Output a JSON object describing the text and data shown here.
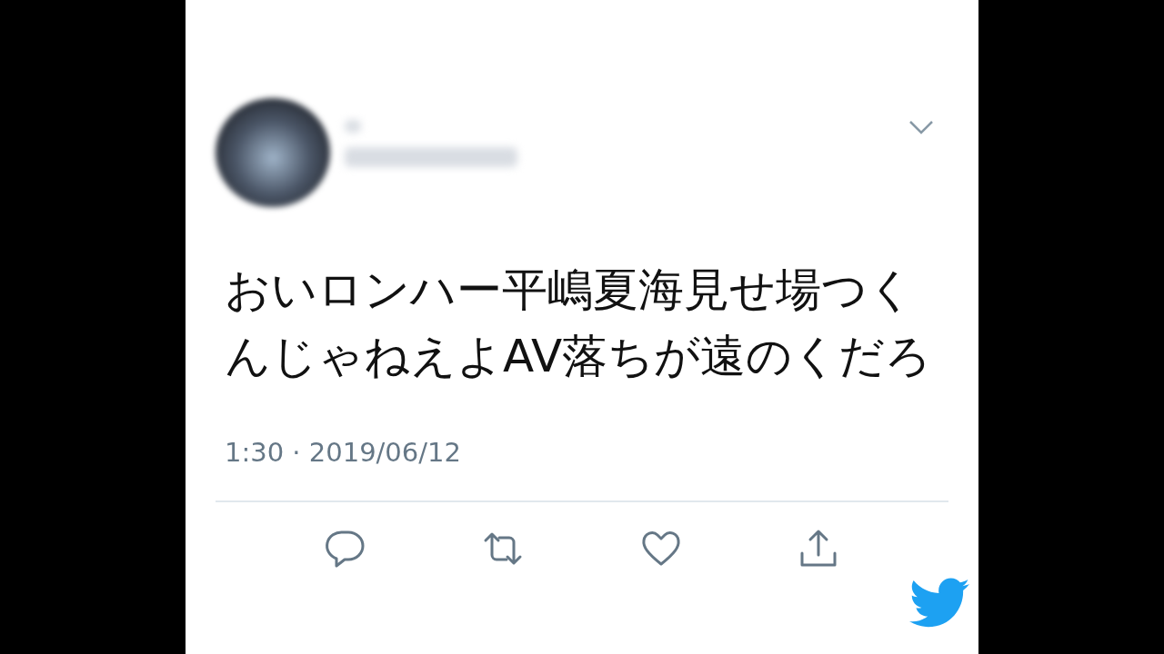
{
  "tweet": {
    "text": "おいロンハー平嶋夏海見せ場つくんじゃねえよAV落ちが遠のくだろ",
    "timestamp": "1:30 · 2019/06/12"
  }
}
